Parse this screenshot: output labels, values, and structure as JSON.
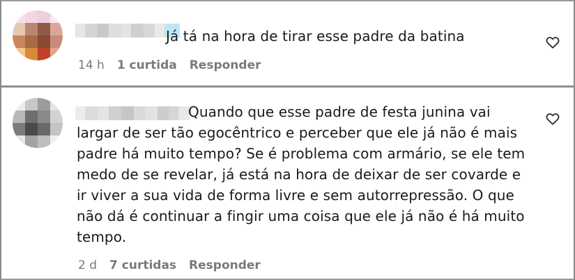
{
  "comments": [
    {
      "text": "Já tá na hora de tirar esse padre da batina",
      "time": "14 h",
      "likes": "1 curtida",
      "reply": "Responder",
      "avatar_colors": [
        "#f7e0ea",
        "#f4d6e3",
        "#eecfdf",
        "#f9e8f0",
        "#e8c8b4",
        "#b98770",
        "#8e5b46",
        "#d9a79a",
        "#c8865a",
        "#a86a45",
        "#8b4a32",
        "#c98a79",
        "#f3c68d",
        "#d88a3a",
        "#c3402a",
        "#e3a58a"
      ],
      "username_colors": [
        "#e6e6e6",
        "#d4d4d4",
        "#c9c9c9",
        "#dedede",
        "#e4e4e4",
        "#cfcfcf",
        "#d8d8d8",
        "#e9e9e9",
        "#bfe6f7"
      ]
    },
    {
      "text": "Quando que esse padre de festa junina vai largar de ser tão egocêntrico e perceber que ele já não é mais padre há muito tempo? Se é problema com armário, se ele tem medo de se revelar, já está na hora de deixar de ser covarde e ir viver a sua vida de forma livre e sem autorrepressão. O que não dá é continuar a fingir uma coisa que ele já não é há muito tempo.",
      "time": "2 d",
      "likes": "7 curtidas",
      "reply": "Responder",
      "avatar_colors": [
        "#ececec",
        "#c7c7c7",
        "#9c9c9c",
        "#e4e4e4",
        "#b8b8b8",
        "#6e6e6e",
        "#8a8a8a",
        "#d2d2d2",
        "#7c7c7c",
        "#4a4a4a",
        "#6a6a6a",
        "#c4c4c4",
        "#e6e6e6",
        "#a3a3a3",
        "#bdbdbd",
        "#f0f0f0"
      ],
      "username_colors": [
        "#ececec",
        "#dcdcdc",
        "#e4e4e4",
        "#d0d0d0",
        "#c6c6c6",
        "#dadada",
        "#e2e2e2",
        "#cdcdcd",
        "#d6d6d6",
        "#e8e8e8"
      ]
    }
  ],
  "icons": {
    "like": "heart-outline-icon"
  }
}
